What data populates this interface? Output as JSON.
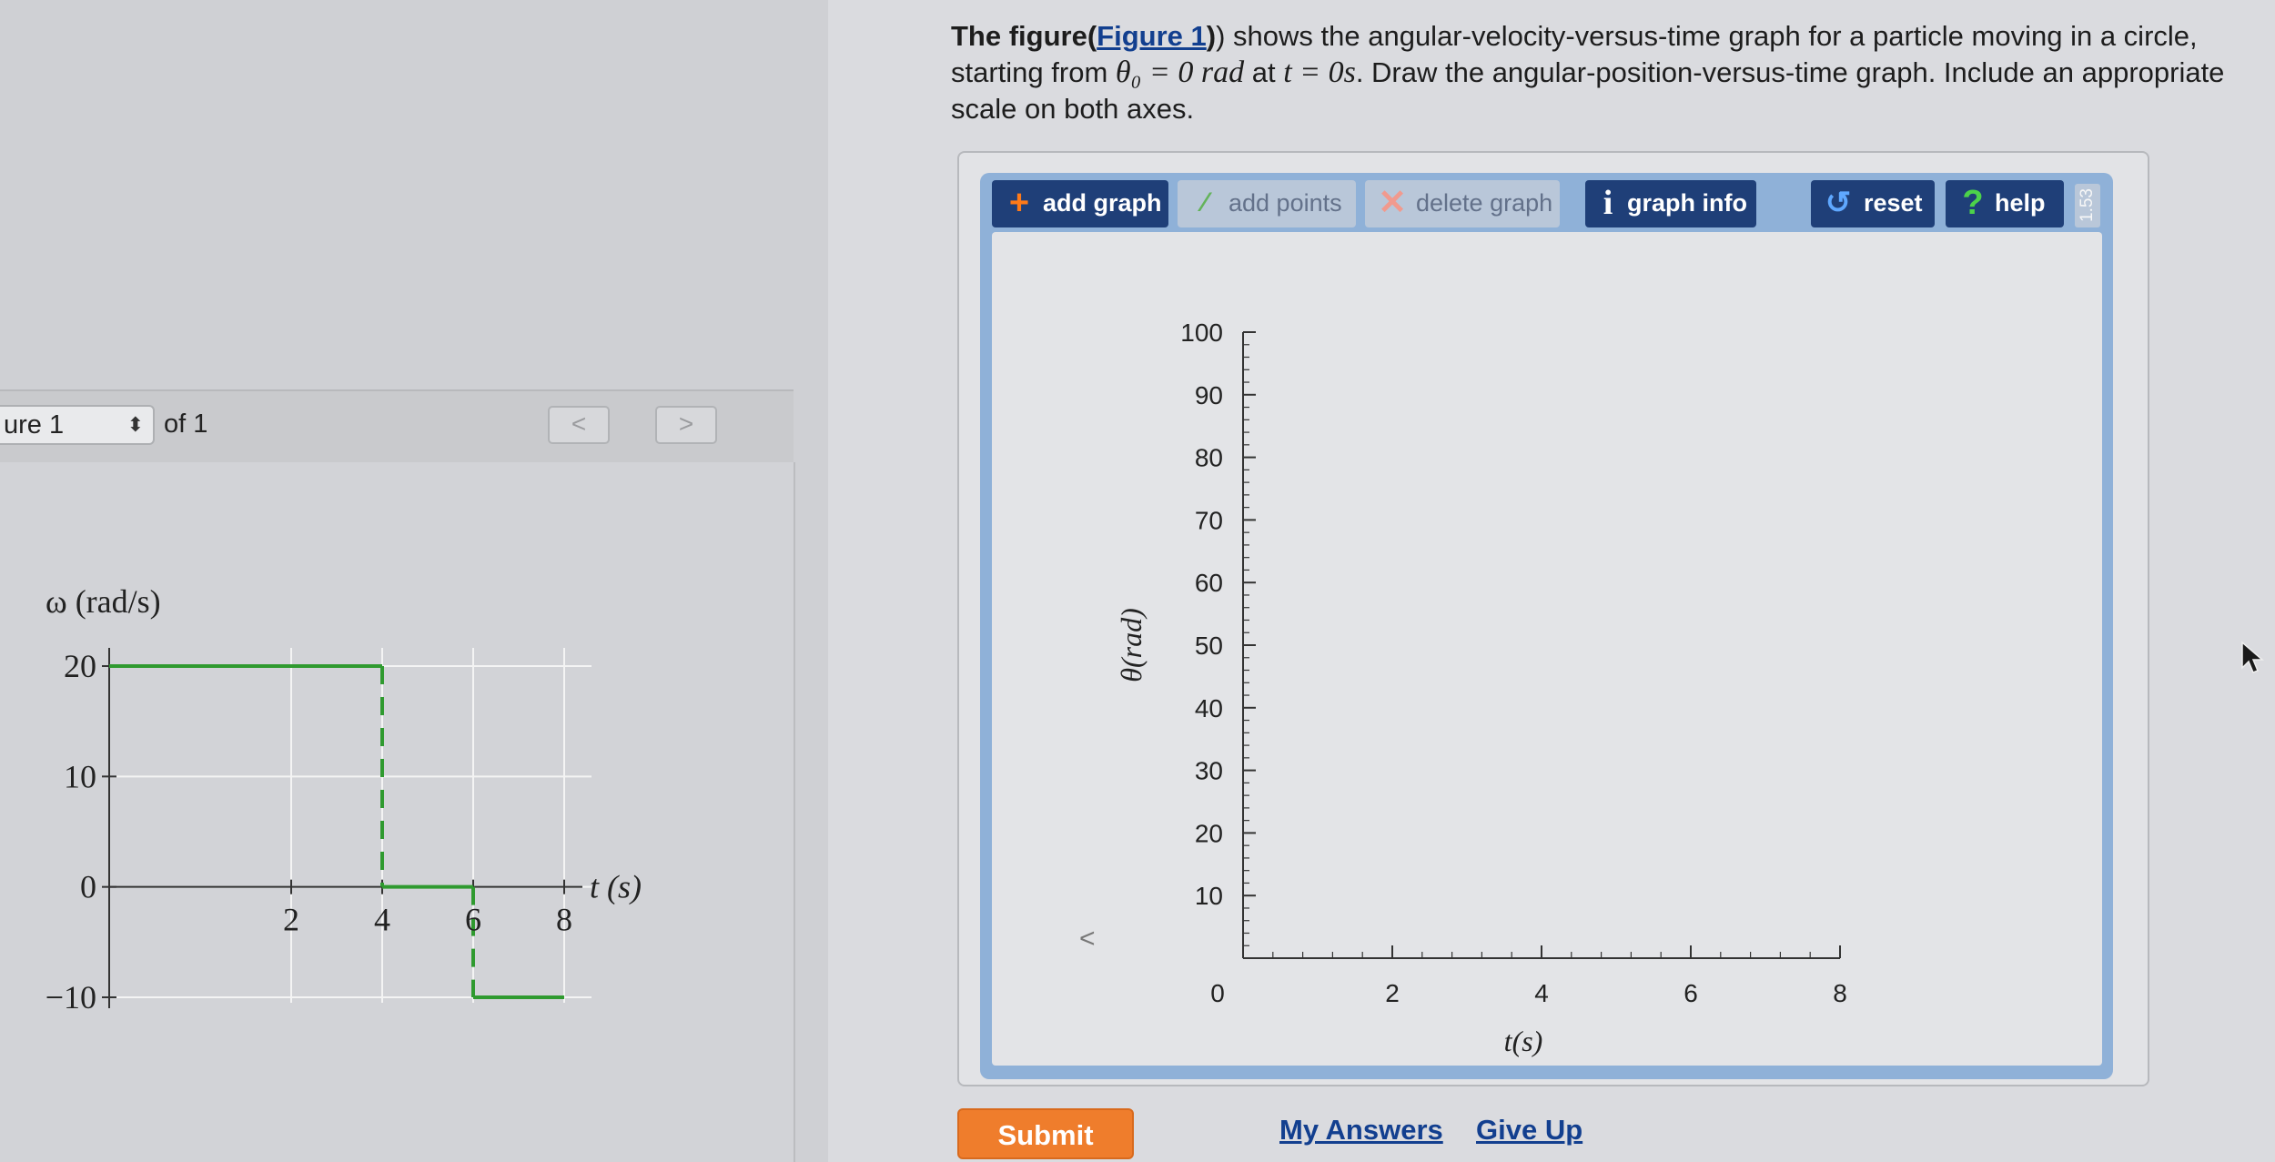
{
  "question": {
    "part1": "The figure(",
    "figure_link": "Figure 1",
    "part2": ") shows the angular-velocity-versus-time graph for a particle moving in a circle, starting from ",
    "math1": "θ₀ = 0 rad",
    "part3": " at ",
    "math2": "t = 0s",
    "part4": ". Draw the angular-position-versus-time graph. Include an appropriate scale on both axes."
  },
  "figure_panel": {
    "selector_label": "ure 1",
    "selector_arrows": "⬍",
    "of_label": "of 1",
    "prev_label": "<",
    "next_label": ">"
  },
  "toolbar": {
    "add_graph": "add graph",
    "add_points": "add points",
    "delete_graph": "delete graph",
    "graph_info": "graph info",
    "reset": "reset",
    "help": "help",
    "version": "1.53"
  },
  "icons": {
    "add_graph": "+",
    "add_points": "⁄",
    "delete_graph": "✕",
    "graph_info": "i",
    "reset": "↺",
    "help": "?"
  },
  "chart_data": [
    {
      "type": "line",
      "title": "",
      "ylabel": "ω (rad/s)",
      "xlabel": "t (s)",
      "xlim": [
        -2,
        8
      ],
      "ylim": [
        -10,
        20
      ],
      "xticks": [
        2,
        4,
        6,
        8
      ],
      "yticks": [
        -10,
        0,
        10,
        20
      ],
      "yticklabels": [
        "−10",
        "0",
        "10",
        "20"
      ],
      "grid": true,
      "series": [
        {
          "segments": [
            {
              "x": [
                -2,
                4
              ],
              "y": [
                20,
                20
              ]
            },
            {
              "x": [
                4,
                6
              ],
              "y": [
                0,
                0
              ]
            },
            {
              "x": [
                6,
                8
              ],
              "y": [
                -10,
                -10
              ]
            }
          ],
          "dashed_transitions": [
            {
              "x": [
                4,
                4
              ],
              "y": [
                20,
                0
              ]
            },
            {
              "x": [
                6,
                6
              ],
              "y": [
                0,
                -10
              ]
            }
          ],
          "color": "#2f9a2f"
        }
      ]
    },
    {
      "type": "line",
      "title": "",
      "ylabel": "θ(rad)",
      "xlabel": "t(s)",
      "xlim": [
        0,
        8
      ],
      "ylim": [
        0,
        100
      ],
      "xticks": [
        0,
        2,
        4,
        6,
        8
      ],
      "yticks": [
        0,
        10,
        20,
        30,
        40,
        50,
        60,
        70,
        80,
        90,
        100
      ],
      "grid": false,
      "series": []
    }
  ],
  "buttons": {
    "submit": "Submit",
    "my_answers": "My Answers",
    "give_up": "Give Up"
  },
  "stray_mark": "<"
}
